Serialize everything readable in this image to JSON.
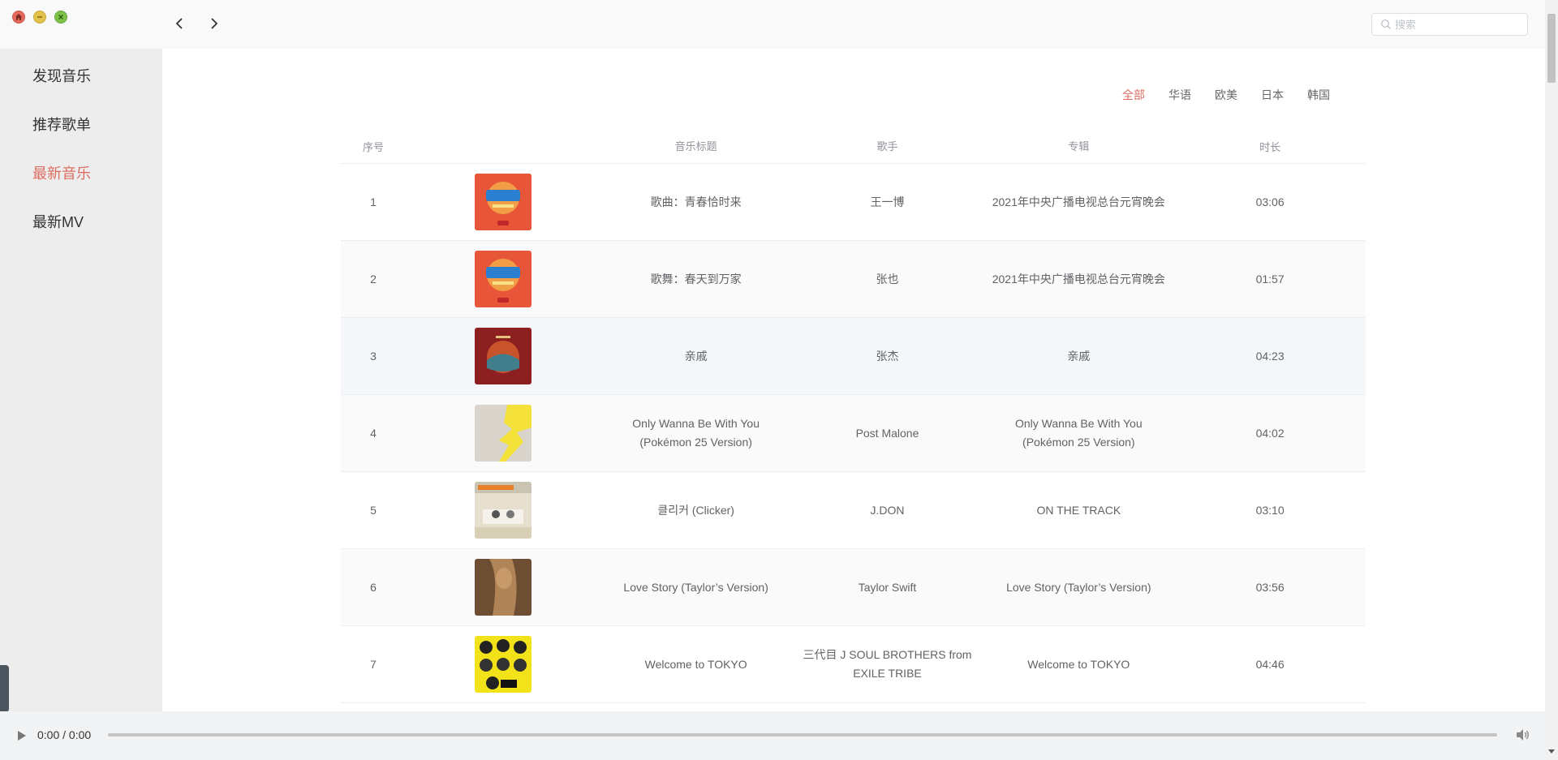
{
  "window": {
    "controls": [
      "close",
      "minimize",
      "maximize"
    ]
  },
  "search": {
    "placeholder": "搜索"
  },
  "sidebar": {
    "items": [
      {
        "label": "发现音乐",
        "active": false
      },
      {
        "label": "推荐歌单",
        "active": false
      },
      {
        "label": "最新音乐",
        "active": true
      },
      {
        "label": "最新MV",
        "active": false
      }
    ]
  },
  "tabs": [
    {
      "label": "全部",
      "active": true
    },
    {
      "label": "华语",
      "active": false
    },
    {
      "label": "欧美",
      "active": false
    },
    {
      "label": "日本",
      "active": false
    },
    {
      "label": "韩国",
      "active": false
    }
  ],
  "table": {
    "headers": {
      "index": "序号",
      "cover": "",
      "title": "音乐标题",
      "artist": "歌手",
      "album": "专辑",
      "duration": "时长"
    },
    "rows": [
      {
        "index": "1",
        "title": "歌曲：青春恰时来",
        "artist": "王一博",
        "album": "2021年中央广播电视总台元宵晚会",
        "duration": "03:06",
        "cover_color": "#e85a3c"
      },
      {
        "index": "2",
        "title": "歌舞：春天到万家",
        "artist": "张也",
        "album": "2021年中央广播电视总台元宵晚会",
        "duration": "01:57",
        "cover_color": "#e85a3c"
      },
      {
        "index": "3",
        "title": "亲戚",
        "artist": "张杰",
        "album": "亲戚",
        "duration": "04:23",
        "cover_color": "#8c1f1f"
      },
      {
        "index": "4",
        "title": "Only Wanna Be With You (Pokémon 25 Version)",
        "artist": "Post Malone",
        "album": "Only Wanna Be With You (Pokémon 25 Version)",
        "duration": "04:02",
        "cover_color": "#d8d4cc"
      },
      {
        "index": "5",
        "title": "클리커 (Clicker)",
        "artist": "J.DON",
        "album": "ON THE TRACK",
        "duration": "03:10",
        "cover_color": "#e4dcc9"
      },
      {
        "index": "6",
        "title": "Love Story (Taylor’s Version)",
        "artist": "Taylor Swift",
        "album": "Love Story (Taylor’s Version)",
        "duration": "03:56",
        "cover_color": "#7a5a3a"
      },
      {
        "index": "7",
        "title": "Welcome to TOKYO",
        "artist": "三代目 J SOUL BROTHERS from EXILE TRIBE",
        "album": "Welcome to TOKYO",
        "duration": "04:46",
        "cover_color": "#f2e21a"
      }
    ]
  },
  "player": {
    "time": "0:00 / 0:00",
    "progress": 0
  },
  "colors": {
    "accent": "#dd6d60",
    "sidebar_bg": "#ededed",
    "topbar_bg": "#f9f9f9",
    "player_bg": "#f1f3f4"
  }
}
